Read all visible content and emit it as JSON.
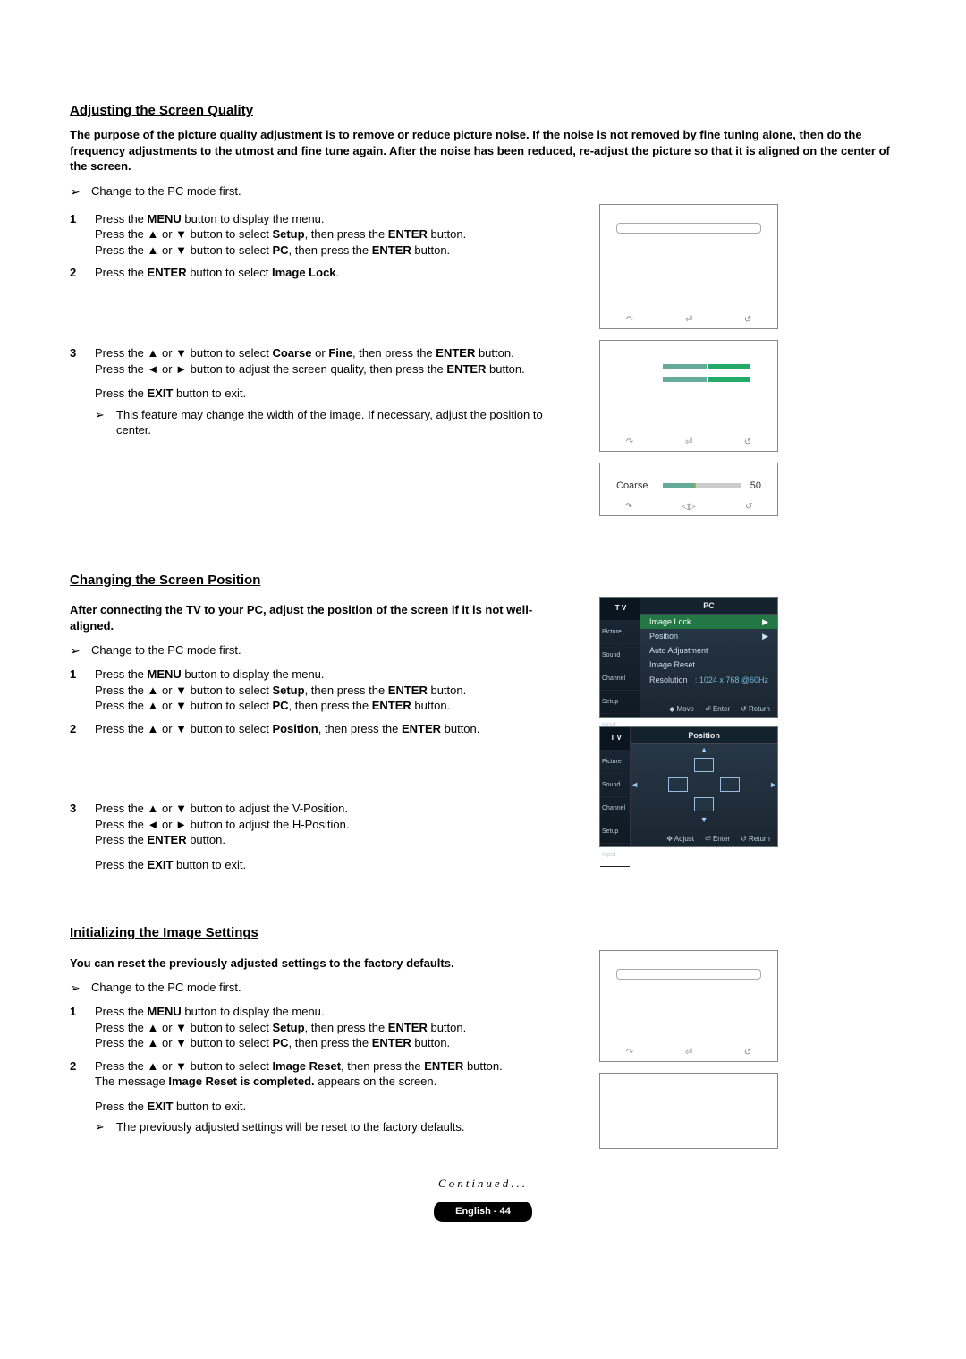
{
  "section1": {
    "title": "Adjusting the Screen Quality",
    "intro": "The purpose of the picture quality adjustment is to remove or reduce picture noise. If the noise is not removed by fine tuning alone, then do the frequency adjustments to the utmost and fine tune again. After the noise has been reduced, re-adjust the picture so that it is aligned on the center of the screen.",
    "tip": "Change to the PC mode first.",
    "steps": {
      "1a": "Press the ",
      "1a_b": "MENU",
      "1a_end": " button to display the menu.",
      "1b": "Press the ▲ or ▼ button to select ",
      "1b_b": "Setup",
      "1b_mid": ", then press the ",
      "1b_b2": "ENTER",
      "1b_end": " button.",
      "1c": "Press the ▲ or ▼ button to select ",
      "1c_b": "PC",
      "1c_mid": ", then press the ",
      "1c_b2": "ENTER",
      "1c_end": " button.",
      "2a": "Press the ",
      "2a_b": "ENTER",
      "2a_mid": " button to select ",
      "2a_b2": "Image Lock",
      "2a_end": ".",
      "3a": "Press the ▲ or ▼ button to select ",
      "3a_b": "Coarse",
      "3a_or": " or ",
      "3a_b2": "Fine",
      "3a_mid": ", then press the ",
      "3a_b3": "ENTER",
      "3a_end": " button.",
      "3b": "Press the ◄ or ► button to adjust the screen quality, then press the ",
      "3b_b": "ENTER",
      "3b_end": " button.",
      "3c": "Press the ",
      "3c_b": "EXIT",
      "3c_end": " button to exit.",
      "3tip": "This feature may change the width of the image. If necessary, adjust the position to center."
    }
  },
  "section2": {
    "title": "Changing the Screen Position",
    "intro": "After connecting the TV to your PC, adjust the position of the screen if it is not well-aligned.",
    "tip": "Change to the PC mode first.",
    "steps": {
      "1": "Press the MENU button to display the menu.\nPress the ▲ or ▼ button to select Setup, then press the ENTER button.\nPress the ▲ or ▼ button to select PC, then press the ENTER button.",
      "2": "Press the ▲ or ▼ button to select Position, then press the ENTER button.",
      "3": "Press the ▲ or ▼ button to adjust the V-Position.\nPress the ◄ or ► button to adjust the H-Position.\nPress the ENTER button.",
      "3exit": "Press the EXIT button to exit."
    }
  },
  "section3": {
    "title": "Initializing the Image Settings",
    "intro": "You can reset the previously adjusted settings to the factory defaults.",
    "tip": "Change to the PC mode first.",
    "steps": {
      "1": "Press the MENU button to display the menu.\nPress the ▲ or ▼ button to select Setup, then press the ENTER button.\nPress the ▲ or ▼ button to select PC, then press the ENTER button.",
      "2a": "Press the ▲ or ▼ button to select ",
      "2a_b": "Image Reset",
      "2a_mid": ", then press the ",
      "2a_b2": "ENTER",
      "2a_end": " button.",
      "2b": "The message ",
      "2b_b": "Image Reset is completed.",
      "2b_end": " appears on the screen.",
      "2exit": "Press the EXIT button to exit.",
      "2tip": "The previously adjusted settings will be reset to the factory defaults."
    }
  },
  "osd_pc": {
    "tv": "T V",
    "title": "PC",
    "side": [
      "Picture",
      "Sound",
      "Channel",
      "Setup",
      "Input"
    ],
    "rows": [
      {
        "l": "Image Lock",
        "r": "▶"
      },
      {
        "l": "Position",
        "r": "▶"
      },
      {
        "l": "Auto Adjustment",
        "r": ""
      },
      {
        "l": "Image Reset",
        "r": ""
      },
      {
        "l": "Resolution",
        "r": ": 1024 x 768 @60Hz"
      }
    ],
    "footer": [
      "◆ Move",
      "⏎ Enter",
      "↺ Return"
    ]
  },
  "osd_pos": {
    "title": "Position",
    "footer": [
      "✥ Adjust",
      "⏎ Enter",
      "↺ Return"
    ]
  },
  "fig_coarse": {
    "label": "Coarse",
    "val": "50"
  },
  "fig_nav": {
    "move": "↷",
    "enter": "⏎",
    "return": "↺",
    "adjust": "◁▷"
  },
  "continued": "Continued...",
  "page": "English - 44"
}
